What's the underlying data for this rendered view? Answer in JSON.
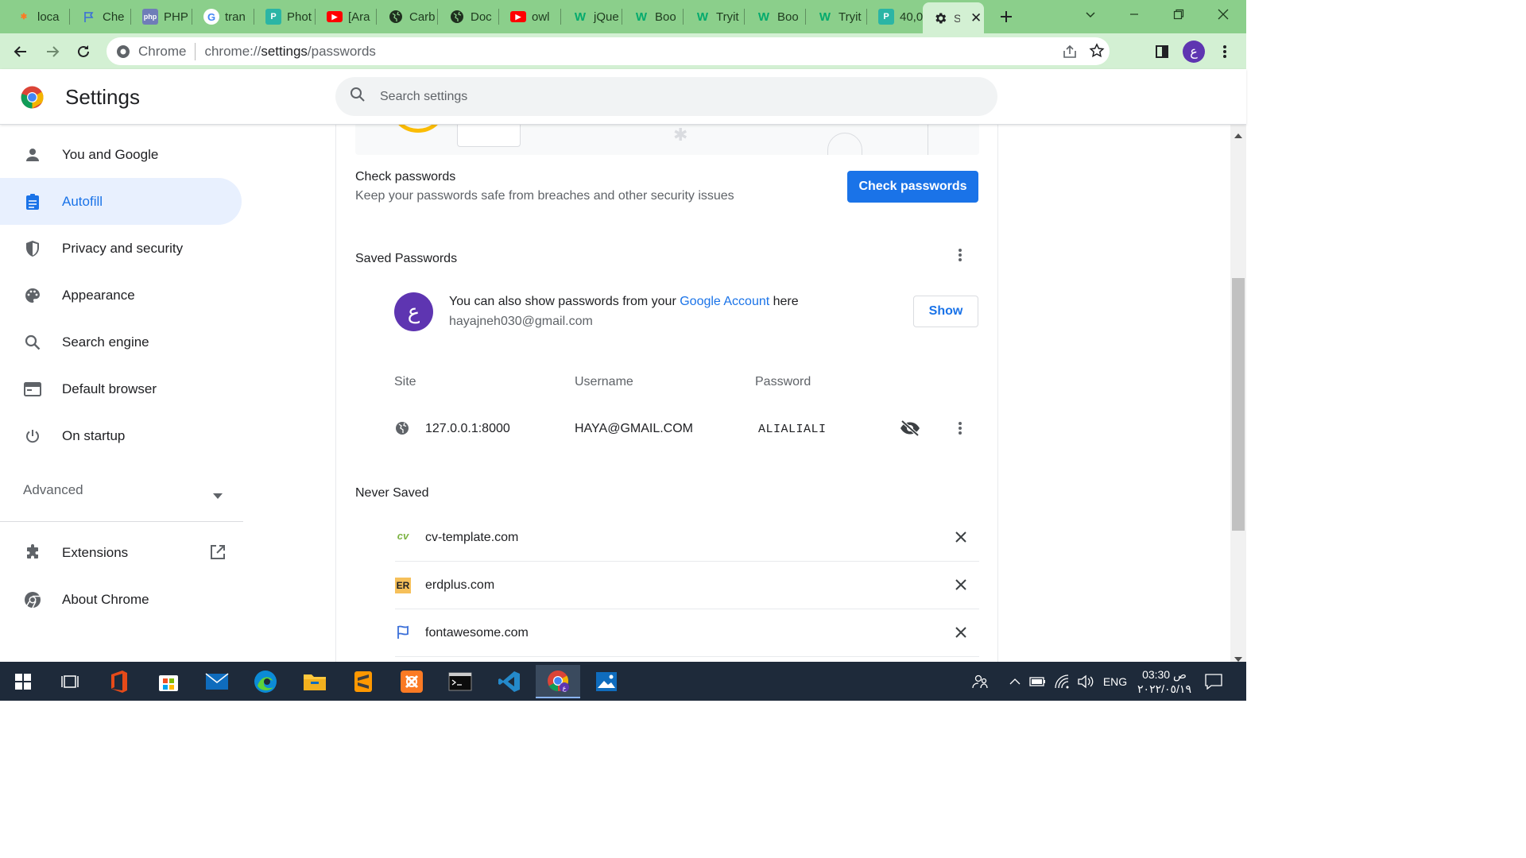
{
  "browser": {
    "tabs": [
      {
        "label": "loca",
        "icon": "xampp-icon"
      },
      {
        "label": "Che",
        "icon": "flag-icon"
      },
      {
        "label": "PHP",
        "icon": "php-icon"
      },
      {
        "label": "tran",
        "icon": "google-icon"
      },
      {
        "label": "Phot",
        "icon": "p-icon"
      },
      {
        "label": "[Ara",
        "icon": "youtube-icon"
      },
      {
        "label": "Carb",
        "icon": "globe-icon"
      },
      {
        "label": "Doc",
        "icon": "globe-icon"
      },
      {
        "label": "owl",
        "icon": "youtube-icon"
      },
      {
        "label": "jQue",
        "icon": "w3schools-icon"
      },
      {
        "label": "Boo",
        "icon": "w3schools-icon"
      },
      {
        "label": "Tryit",
        "icon": "w3schools-icon"
      },
      {
        "label": "Boo",
        "icon": "w3schools-icon"
      },
      {
        "label": "Tryit",
        "icon": "w3schools-icon"
      },
      {
        "label": "40,0",
        "icon": "p-icon"
      }
    ],
    "active_tab": {
      "label": "S",
      "icon": "gear-icon"
    },
    "omnibox": {
      "chip": "Chrome",
      "url_prefix": "chrome://",
      "url_host": "settings",
      "url_path": "/passwords"
    },
    "profile_initial": "ع"
  },
  "settings": {
    "title": "Settings",
    "search_placeholder": "Search settings",
    "nav": {
      "you_and_google": "You and Google",
      "autofill": "Autofill",
      "privacy": "Privacy and security",
      "appearance": "Appearance",
      "search_engine": "Search engine",
      "default_browser": "Default browser",
      "on_startup": "On startup",
      "advanced": "Advanced",
      "extensions": "Extensions",
      "about": "About Chrome"
    }
  },
  "passwords": {
    "check_title": "Check passwords",
    "check_desc": "Keep your passwords safe from breaches and other security issues",
    "check_button": "Check passwords",
    "saved_title": "Saved Passwords",
    "account": {
      "avatar_initial": "ع",
      "text_before": "You can also show passwords from your ",
      "link": "Google Account",
      "text_after": " here",
      "email": "hayajneh030@gmail.com",
      "show_button": "Show"
    },
    "columns": {
      "site": "Site",
      "username": "Username",
      "password": "Password"
    },
    "rows": [
      {
        "site": "127.0.0.1:8000",
        "username": "HAYA@GMAIL.COM",
        "password": "ALIALIALI"
      }
    ],
    "never_saved_title": "Never Saved",
    "never_saved": [
      {
        "site": "cv-template.com",
        "icon_text": "cv"
      },
      {
        "site": "erdplus.com",
        "icon_text": "ER"
      },
      {
        "site": "fontawesome.com",
        "icon_text": ""
      }
    ]
  },
  "taskbar": {
    "language": "ENG",
    "time": "03:30 ص",
    "date": "٢٠٢٢/٠٥/١٩"
  },
  "colors": {
    "accent": "#1a73e8",
    "tabstrip": "#8bcf8b",
    "toolbar": "#d3f0d3",
    "avatar": "#5e35b1"
  }
}
